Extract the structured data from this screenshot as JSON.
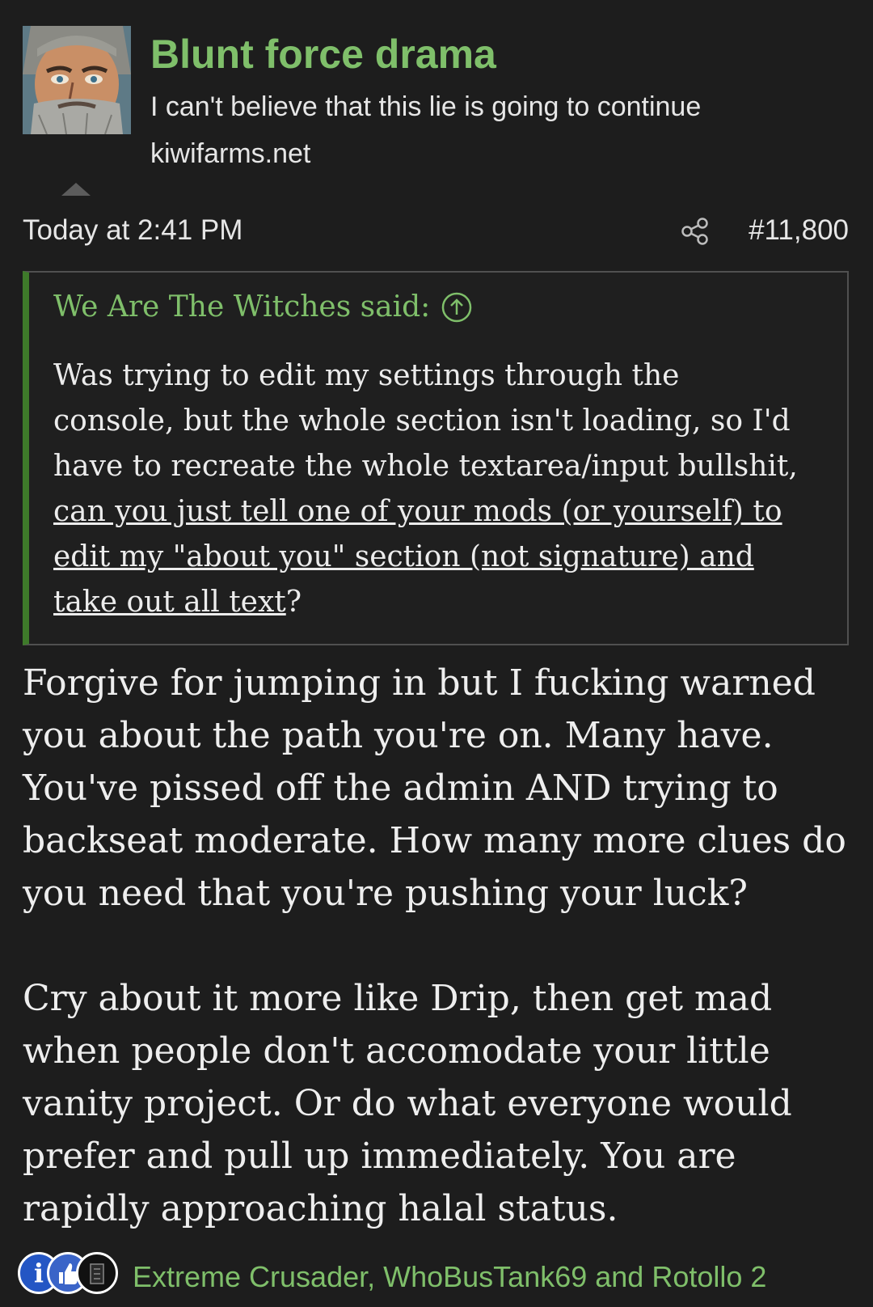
{
  "post": {
    "username": "Blunt force drama",
    "user_title": "I can't believe that this lie is going to continue",
    "user_site": "kiwifarms.net",
    "timestamp": "Today at 2:41 PM",
    "post_number": "#11,800"
  },
  "quote": {
    "author": "We Are The Witches said:",
    "text_plain": "Was trying to edit my settings through the console, but the whole section isn't loading, so I'd have to recreate the whole textarea/input bullshit, ",
    "text_underlined": "can you just tell one of your mods (or yourself) to edit my \"about you\" section (not signature) and take out all text",
    "text_end": "?"
  },
  "body": {
    "paragraph_1": "Forgive for jumping in but I fucking warned you about the path you're on. Many have. You've pissed off the admin AND trying to backseat moderate. How many more clues do you need that you're pushing your luck?",
    "paragraph_2": "Cry about it more like Drip, then get mad when people don't accomodate your little vanity project. Or do what everyone would prefer and pull up immediately. You are rapidly approaching halal status."
  },
  "reactions": {
    "names": "Extreme Crusader, WhoBusTank69 and Rotollo 2",
    "icons": [
      "informative-icon",
      "like-icon",
      "reaction-icon"
    ],
    "info_glyph": "i"
  },
  "colors": {
    "accent_green": "#7fbf6a",
    "quote_bar": "#3e7a2a",
    "background": "#1d1d1d"
  }
}
